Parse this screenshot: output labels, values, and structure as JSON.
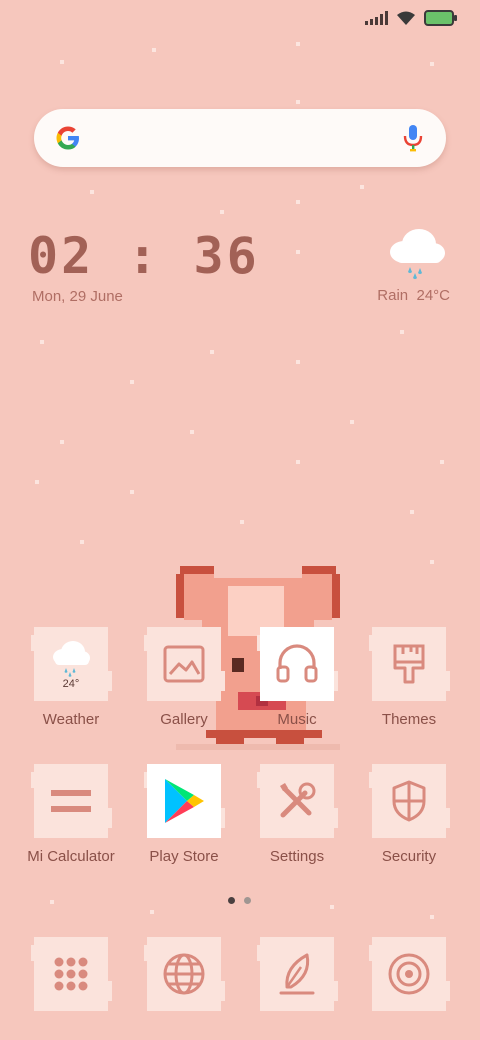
{
  "status_bar": {
    "signal_icon": "cellular-signal-icon",
    "wifi_icon": "wifi-icon",
    "battery_icon": "battery-charging-icon"
  },
  "search_bar": {
    "logo_icon": "google-g-icon",
    "voice_icon": "microphone-icon"
  },
  "clock_widget": {
    "time": "02 : 36",
    "date": "Mon, 29 June"
  },
  "weather_widget": {
    "icon": "rain-cloud-icon",
    "condition": "Rain",
    "temperature": "24°C"
  },
  "apps_row1": [
    {
      "label": "Weather",
      "icon": "weather-icon",
      "temp": "24°"
    },
    {
      "label": "Gallery",
      "icon": "gallery-icon"
    },
    {
      "label": "Music",
      "icon": "headphones-icon"
    },
    {
      "label": "Themes",
      "icon": "paintbrush-icon"
    }
  ],
  "apps_row2": [
    {
      "label": "Mi Calculator",
      "icon": "calculator-icon"
    },
    {
      "label": "Play Store",
      "icon": "play-store-icon"
    },
    {
      "label": "Settings",
      "icon": "tools-icon"
    },
    {
      "label": "Security",
      "icon": "shield-icon"
    }
  ],
  "dock": [
    {
      "icon": "app-drawer-icon"
    },
    {
      "icon": "browser-globe-icon"
    },
    {
      "icon": "notes-feather-icon"
    },
    {
      "icon": "camera-icon"
    }
  ],
  "pager": {
    "pages": 2,
    "active": 1
  },
  "colors": {
    "wallpaper": "#f6c7bd",
    "tile": "#fbe3dc",
    "icon_stroke": "#d98a7e",
    "text": "#8a5048"
  }
}
